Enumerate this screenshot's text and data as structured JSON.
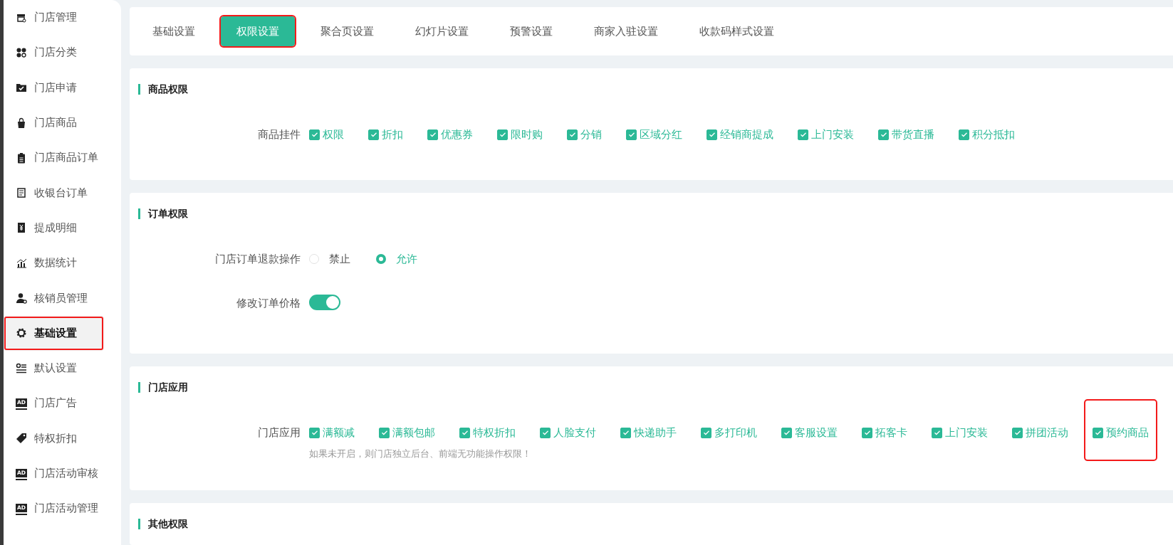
{
  "sidebar": {
    "items": [
      {
        "label": "门店管理",
        "selected": false,
        "annotated": false
      },
      {
        "label": "门店分类",
        "selected": false,
        "annotated": false
      },
      {
        "label": "门店申请",
        "selected": false,
        "annotated": false
      },
      {
        "label": "门店商品",
        "selected": false,
        "annotated": false
      },
      {
        "label": "门店商品订单",
        "selected": false,
        "annotated": false
      },
      {
        "label": "收银台订单",
        "selected": false,
        "annotated": false
      },
      {
        "label": "提成明细",
        "selected": false,
        "annotated": false
      },
      {
        "label": "数据统计",
        "selected": false,
        "annotated": false
      },
      {
        "label": "核销员管理",
        "selected": false,
        "annotated": false
      },
      {
        "label": "基础设置",
        "selected": true,
        "annotated": true
      },
      {
        "label": "默认设置",
        "selected": false,
        "annotated": false
      },
      {
        "label": "门店广告",
        "icon_text": "AD",
        "selected": false,
        "annotated": false
      },
      {
        "label": "特权折扣",
        "selected": false,
        "annotated": false
      },
      {
        "label": "门店活动审核",
        "icon_text": "AD",
        "selected": false,
        "annotated": false
      },
      {
        "label": "门店活动管理",
        "icon_text": "AD",
        "selected": false,
        "annotated": false
      }
    ]
  },
  "tabs": [
    {
      "label": "基础设置",
      "selected": false,
      "annotated": false
    },
    {
      "label": "权限设置",
      "selected": true,
      "annotated": true
    },
    {
      "label": "聚合页设置",
      "selected": false,
      "annotated": false
    },
    {
      "label": "幻灯片设置",
      "selected": false,
      "annotated": false
    },
    {
      "label": "预警设置",
      "selected": false,
      "annotated": false
    },
    {
      "label": "商家入驻设置",
      "selected": false,
      "annotated": false
    },
    {
      "label": "收款码样式设置",
      "selected": false,
      "annotated": false
    }
  ],
  "sections": [
    {
      "title": "商品权限",
      "rows": [
        {
          "kind": "checkboxes",
          "label": "商品挂件",
          "options": [
            {
              "label": "权限",
              "checked": true,
              "annotated": false
            },
            {
              "label": "折扣",
              "checked": true,
              "annotated": false
            },
            {
              "label": "优惠券",
              "checked": true,
              "annotated": false
            },
            {
              "label": "限时购",
              "checked": true,
              "annotated": false
            },
            {
              "label": "分销",
              "checked": true,
              "annotated": false
            },
            {
              "label": "区域分红",
              "checked": true,
              "annotated": false
            },
            {
              "label": "经销商提成",
              "checked": true,
              "annotated": false
            },
            {
              "label": "上门安装",
              "checked": true,
              "annotated": false
            },
            {
              "label": "带货直播",
              "checked": true,
              "annotated": false
            },
            {
              "label": "积分抵扣",
              "checked": true,
              "annotated": false
            }
          ]
        }
      ]
    },
    {
      "title": "订单权限",
      "rows": [
        {
          "kind": "radios",
          "label": "门店订单退款操作",
          "options": [
            {
              "label": "禁止",
              "selected": false
            },
            {
              "label": "允许",
              "selected": true
            }
          ]
        },
        {
          "kind": "switch",
          "label": "修改订单价格",
          "on": true
        }
      ]
    },
    {
      "title": "门店应用",
      "rows": [
        {
          "kind": "checkboxes",
          "label": "门店应用",
          "hint": "如果未开启，则门店独立后台、前端无功能操作权限！",
          "options": [
            {
              "label": "满额减",
              "checked": true,
              "annotated": false
            },
            {
              "label": "满额包邮",
              "checked": true,
              "annotated": false
            },
            {
              "label": "特权折扣",
              "checked": true,
              "annotated": false
            },
            {
              "label": "人脸支付",
              "checked": true,
              "annotated": false
            },
            {
              "label": "快递助手",
              "checked": true,
              "annotated": false
            },
            {
              "label": "多打印机",
              "checked": true,
              "annotated": false
            },
            {
              "label": "客服设置",
              "checked": true,
              "annotated": false
            },
            {
              "label": "拓客卡",
              "checked": true,
              "annotated": false
            },
            {
              "label": "上门安装",
              "checked": true,
              "annotated": false
            },
            {
              "label": "拼团活动",
              "checked": true,
              "annotated": false
            },
            {
              "label": "预约商品",
              "checked": true,
              "annotated": true
            }
          ]
        }
      ]
    },
    {
      "title": "其他权限"
    }
  ]
}
